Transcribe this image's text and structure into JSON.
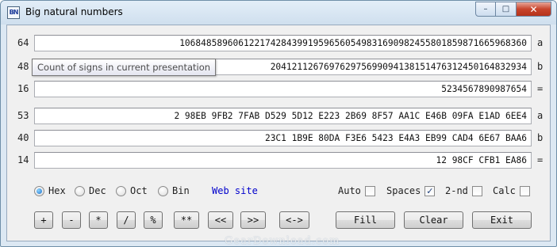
{
  "window": {
    "title": "Big natural numbers",
    "app_icon_text": "BN",
    "controls": {
      "minimize": "–",
      "maximize": "□",
      "close": "✕"
    }
  },
  "rows_dec": [
    {
      "count": "64",
      "value": "10684858960612217428439919596560549831690982455801859871665968360",
      "suffix": "a"
    },
    {
      "count": "48",
      "value": "204121126769762975699094138151476312450164832934",
      "suffix": "b"
    },
    {
      "count": "16",
      "value": "5234567890987654",
      "suffix": "="
    }
  ],
  "rows_hex": [
    {
      "count": "53",
      "value": "2 98EB 9FB2 7FAB D529 5D12 E223 2B69 8F57 AA1C E46B 09FA E1AD 6EE4",
      "suffix": "a"
    },
    {
      "count": "40",
      "value": "23C1 1B9E 80DA F3E6 5423 E4A3 EB99 CAD4 6E67 BAA6",
      "suffix": "b"
    },
    {
      "count": "14",
      "value": "12 98CF CFB1 EA86",
      "suffix": "="
    }
  ],
  "tooltip": "Count of signs in current presentation",
  "radix": {
    "options": [
      "Hex",
      "Dec",
      "Oct",
      "Bin"
    ],
    "selected": "Hex"
  },
  "web_site": "Web site",
  "options": {
    "auto": {
      "label": "Auto",
      "checked": false
    },
    "spaces": {
      "label": "Spaces",
      "checked": true
    },
    "second": {
      "label": "2-nd",
      "checked": false
    },
    "calc": {
      "label": "Calc",
      "checked": false
    }
  },
  "buttons": {
    "add": "+",
    "sub": "-",
    "mul": "*",
    "div": "/",
    "mod": "%",
    "pow": "**",
    "shl": "<<",
    "shr": ">>",
    "swap": "<->",
    "fill": "Fill",
    "clear": "Clear",
    "exit": "Exit"
  },
  "watermark": "GearDownload.com"
}
